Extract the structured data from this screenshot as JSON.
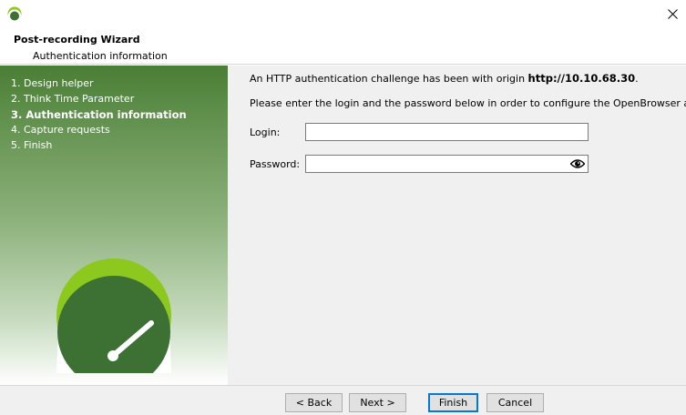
{
  "header": {
    "title": "Post-recording Wizard",
    "subtitle": "Authentication information"
  },
  "steps": [
    {
      "label": "1. Design helper",
      "active": false
    },
    {
      "label": "2. Think Time Parameter",
      "active": false
    },
    {
      "label": "3. Authentication information",
      "active": true
    },
    {
      "label": "4. Capture requests",
      "active": false
    },
    {
      "label": "5. Finish",
      "active": false
    }
  ],
  "content": {
    "challenge_prefix": "An HTTP authentication challenge has been with origin ",
    "origin": "http://10.10.68.30",
    "challenge_suffix": ".",
    "instructions": "Please enter the login and the password below in order to configure the OpenBrowser action.",
    "login_label": "Login:",
    "login_value": "",
    "password_label": "Password:",
    "password_value": ""
  },
  "buttons": {
    "back": "< Back",
    "next": "Next >",
    "finish": "Finish",
    "cancel": "Cancel"
  },
  "colors": {
    "brand_green": "#4a7d36",
    "logo_lime": "#8dc81e",
    "logo_dark": "#3d7033",
    "focus_blue": "#0078d7"
  },
  "icons": {
    "app": "neoload-icon",
    "close": "close-icon",
    "password_toggle": "eye-icon",
    "logo": "speedometer-logo"
  }
}
